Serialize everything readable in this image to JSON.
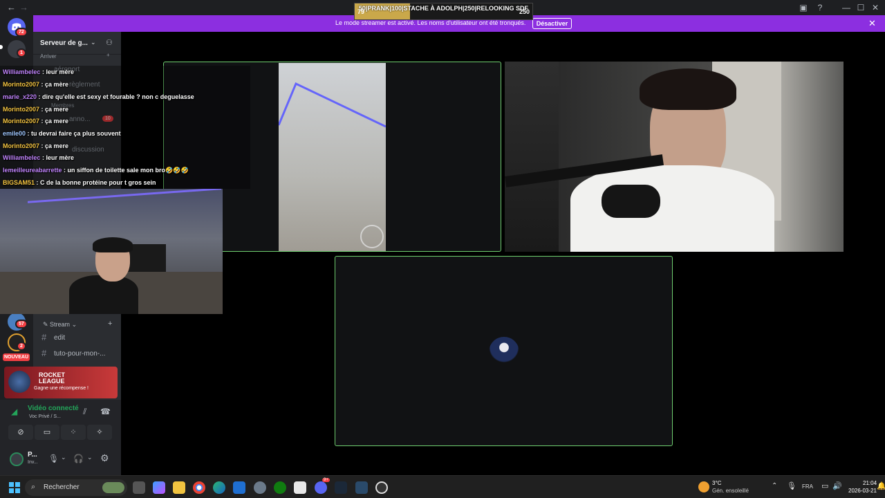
{
  "titlebar": {
    "back": "←",
    "forward": "→"
  },
  "goal": {
    "left": "79",
    "right": "250",
    "text": "50|PRANK|100|STACHE À ADOLPH|250|RELOOKING SDF",
    "progress": 0.31
  },
  "banner": {
    "message": "Le mode streamer est activé. Les noms d'utilisateur ont été tronqués.",
    "button": "Désactiver"
  },
  "rail": {
    "badges": [
      "72",
      "1",
      "57",
      "2"
    ],
    "new_label": "NOUVEAU"
  },
  "server": {
    "name": "Serveur de g...",
    "cat_arrive": "Arriver",
    "ch_aeroport": "aéroport",
    "ch_reglement": "règlement",
    "cat_membres": "Membres",
    "ch_annonces": "anno...",
    "annonces_badge": "10",
    "ch_discussion": "discussion",
    "cat_stream": "Stream",
    "ch_edit": "edit",
    "ch_tuto": "tuto-pour-mon-..."
  },
  "promo": {
    "title": "ROCKET LEAGUE",
    "subtitle": "Gagne une récompense !"
  },
  "voice": {
    "status": "Vidéo connecté",
    "channel": "Voc Privé / S..."
  },
  "user": {
    "name": "P...",
    "status": "Inv..."
  },
  "chat": [
    {
      "user": "Williambelec",
      "color": "#c084fc",
      "msg": "leur mère"
    },
    {
      "user": "Morinto2007",
      "color": "#f5c542",
      "msg": "ça mère"
    },
    {
      "user": "marie_x220",
      "color": "#c084fc",
      "msg": "dire qu'elle est sexy et fourable ? non c deguelasse"
    },
    {
      "user": "Morinto2007",
      "color": "#f5c542",
      "msg": "ça mere"
    },
    {
      "user": "Morinto2007",
      "color": "#f5c542",
      "msg": "ça mere"
    },
    {
      "user": "emile00",
      "color": "#9fc7ff",
      "msg": "tu devrai faire ça plus souvent"
    },
    {
      "user": "Morinto2007",
      "color": "#f5c542",
      "msg": "ça mere"
    },
    {
      "user": "Williambelec",
      "color": "#c084fc",
      "msg": "leur mère"
    },
    {
      "user": "lemeilleureabarrette",
      "color": "#c084fc",
      "msg": "un siffon de toilette sale mon bro🤣🤣🤣"
    },
    {
      "user": "BIGSAM51",
      "color": "#f5c542",
      "msg": "C de la bonne protéine pour t gros sein"
    }
  ],
  "taskbar": {
    "search": "Rechercher",
    "weather_temp": "3°C",
    "weather_desc": "Gén. ensoleillé",
    "lang": "FRA",
    "time": "21:04",
    "date": "2026-03-21",
    "discord_badge": "9+"
  }
}
